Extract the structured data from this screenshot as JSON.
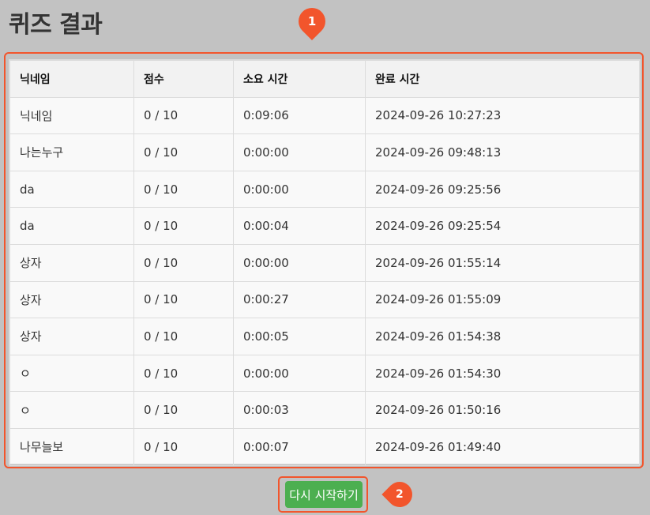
{
  "page": {
    "title": "퀴즈 결과"
  },
  "markers": {
    "one": "1",
    "two": "2"
  },
  "colors": {
    "accent": "#f2552c",
    "button": "#4caf50",
    "background": "#c2c2c2"
  },
  "results": {
    "headers": [
      "닉네임",
      "점수",
      "소요 시간",
      "완료 시간"
    ],
    "rows": [
      [
        "닉네임",
        "0 / 10",
        "0:09:06",
        "2024-09-26 10:27:23"
      ],
      [
        "나는누구",
        "0 / 10",
        "0:00:00",
        "2024-09-26 09:48:13"
      ],
      [
        "da",
        "0 / 10",
        "0:00:00",
        "2024-09-26 09:25:56"
      ],
      [
        "da",
        "0 / 10",
        "0:00:04",
        "2024-09-26 09:25:54"
      ],
      [
        "상자",
        "0 / 10",
        "0:00:00",
        "2024-09-26 01:55:14"
      ],
      [
        "상자",
        "0 / 10",
        "0:00:27",
        "2024-09-26 01:55:09"
      ],
      [
        "상자",
        "0 / 10",
        "0:00:05",
        "2024-09-26 01:54:38"
      ],
      [
        "ㅇ",
        "0 / 10",
        "0:00:00",
        "2024-09-26 01:54:30"
      ],
      [
        "ㅇ",
        "0 / 10",
        "0:00:03",
        "2024-09-26 01:50:16"
      ],
      [
        "나무늘보",
        "0 / 10",
        "0:00:07",
        "2024-09-26 01:49:40"
      ]
    ]
  },
  "actions": {
    "restart_label": "다시 시작하기"
  }
}
